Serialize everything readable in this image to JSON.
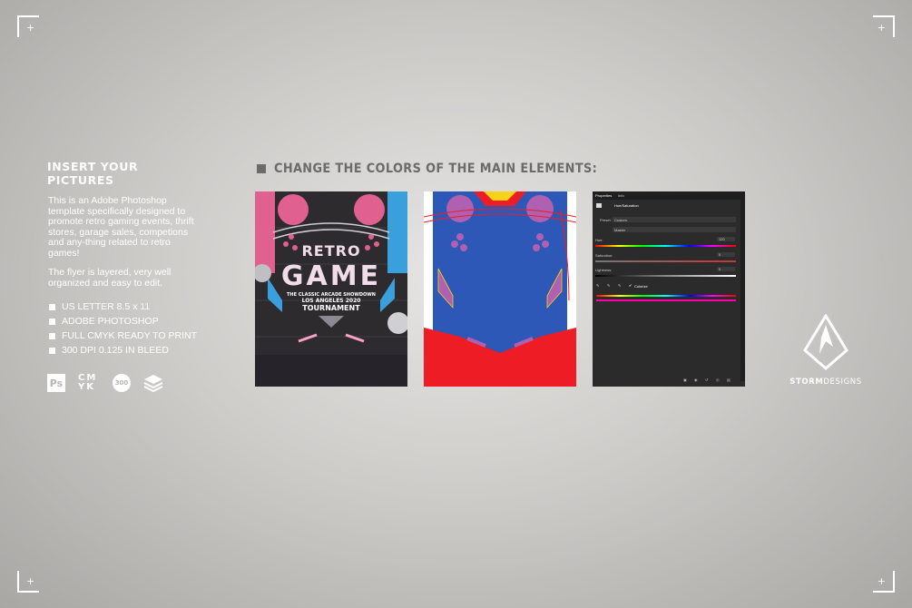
{
  "left": {
    "title": "INSERT YOUR PICTURES",
    "paragraph1": "This is an Adobe Photoshop template specifically designed to promote retro gaming events, thrift stores, garage sales, competions and any-thing related to retro games!",
    "paragraph2": "The flyer is layered, very well organized and easy to edit.",
    "features": [
      "US LETTER 8.5 x 11",
      "ADOBE PHOTOSHOP",
      "FULL CMYK READY TO PRINT",
      "300 DPI 0.125 IN BLEED"
    ],
    "icons": [
      "photoshop-icon",
      "cmyk-icon",
      "300-dpi-icon",
      "layers-icon"
    ],
    "ps_label": "Ps",
    "cmyk_label": "CM YK",
    "dpi_label": "300"
  },
  "main": {
    "title": "CHANGE THE COLORS OF THE MAIN ELEMENTS:"
  },
  "flyer": {
    "title_top": "RETRO",
    "title_main": "GAME",
    "subtitle": "THE CLASSIC ARCADE SHOWDOWN",
    "event": "LOS ANGELES 2020",
    "event2": "TOURNAMENT"
  },
  "photoshop_panel": {
    "tabs": [
      "Properties",
      "Info"
    ],
    "header": "Hue/Saturation",
    "preset_label": "Preset:",
    "preset_value": "Custom",
    "channel_value": "Master",
    "hue_label": "Hue:",
    "hue_value": "120",
    "saturation_label": "Saturation:",
    "saturation_value": "0",
    "lightness_label": "Lightness:",
    "lightness_value": "0",
    "colorize_label": "Colorize"
  },
  "brand": {
    "name_bold": "STORM",
    "name_rest": "DESIGNS"
  },
  "colors": {
    "background": "#d7d6d4",
    "flyer_dark": "#2d2b2e",
    "pink": "#e0608f",
    "blue": "#2e58b7",
    "red": "#ee1c25",
    "purple": "#b060b0",
    "cyan": "#3aa0dd"
  }
}
